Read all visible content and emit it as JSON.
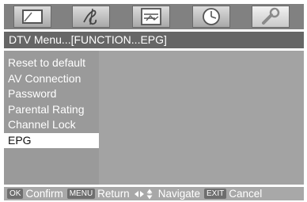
{
  "icon_bar": {
    "icons": [
      {
        "name": "picture-icon",
        "active": false
      },
      {
        "name": "music-icon",
        "active": false
      },
      {
        "name": "channel-icon",
        "active": false
      },
      {
        "name": "clock-icon",
        "active": false
      },
      {
        "name": "wrench-icon",
        "active": true
      }
    ]
  },
  "title": "DTV Menu...[FUNCTION...EPG]",
  "menu": {
    "items": [
      {
        "label": "Reset to default"
      },
      {
        "label": "AV Connection"
      },
      {
        "label": "Password"
      },
      {
        "label": "Parental Rating"
      },
      {
        "label": "Channel Lock"
      },
      {
        "label": "EPG",
        "selected": true
      }
    ]
  },
  "help": {
    "ok_key": "OK",
    "ok_label": "Confirm",
    "menu_key": "MENU",
    "menu_label": "Return",
    "navigate_label": "Navigate",
    "exit_key": "EXIT",
    "exit_label": "Cancel"
  },
  "colors": {
    "icon_bar_bg": "#818181",
    "title_bg": "#666666",
    "menu_bg": "#9a9a9a",
    "content_bg": "#a3a3a3",
    "help_bg": "#a8a8a8",
    "selected_bg": "#ffffff"
  }
}
